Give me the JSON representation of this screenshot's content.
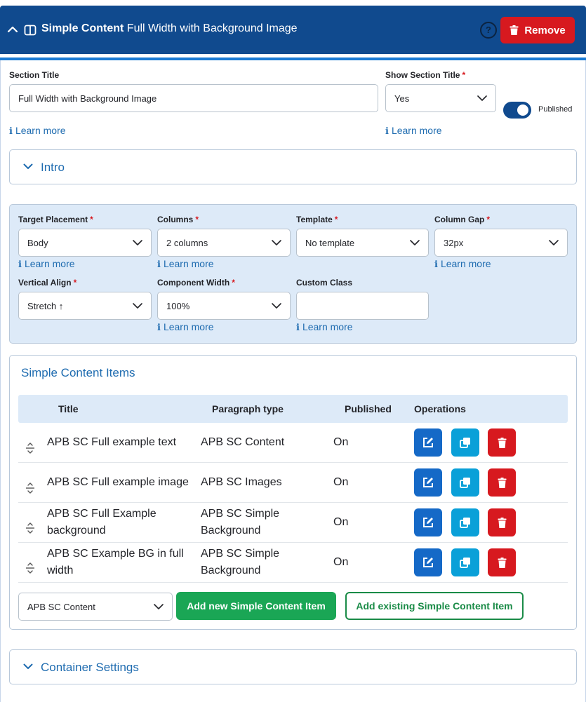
{
  "header": {
    "title_bold": "Simple Content",
    "title_rest": "Full Width with Background Image",
    "help_label": "?",
    "remove_label": "Remove"
  },
  "section_title": {
    "label": "Section Title",
    "value": "Full Width with Background Image",
    "learn_more": "Learn more"
  },
  "show_section_title": {
    "label": "Show Section Title",
    "required": "*",
    "value": "Yes",
    "learn_more": "Learn more"
  },
  "published_toggle": {
    "label": "Published",
    "on": true
  },
  "intro": {
    "label": "Intro"
  },
  "settings": {
    "target_placement": {
      "label": "Target Placement",
      "required": "*",
      "value": "Body",
      "learn_more": "Learn more"
    },
    "columns": {
      "label": "Columns",
      "required": "*",
      "value": "2 columns",
      "learn_more": "Learn more"
    },
    "template": {
      "label": "Template",
      "required": "*",
      "value": "No template"
    },
    "column_gap": {
      "label": "Column Gap",
      "required": "*",
      "value": "32px",
      "learn_more": "Learn more"
    },
    "vertical_align": {
      "label": "Vertical Align",
      "required": "*",
      "value": "Stretch ↑"
    },
    "component_width": {
      "label": "Component Width",
      "required": "*",
      "value": "100%",
      "learn_more": "Learn more"
    },
    "custom_class": {
      "label": "Custom Class",
      "value": "",
      "learn_more": "Learn more"
    }
  },
  "items_section": {
    "title": "Simple Content Items",
    "columns": [
      "Title",
      "Paragraph type",
      "Published",
      "Operations"
    ],
    "rows": [
      {
        "title": "APB SC Full example text",
        "type": "APB SC Content",
        "published": "On"
      },
      {
        "title": "APB SC Full example image",
        "type": "APB SC Images",
        "published": "On"
      },
      {
        "title": "APB SC Full Example background",
        "type": "APB SC Simple Background",
        "published": "On"
      },
      {
        "title": "APB SC Example BG in full width",
        "type": "APB SC Simple Background",
        "published": "On"
      }
    ],
    "add_type_value": "APB SC Content",
    "add_new_label": "Add new Simple Content Item",
    "add_existing_label": "Add existing Simple Content Item"
  },
  "container_settings": {
    "label": "Container Settings"
  },
  "colors": {
    "header_bg": "#104a8e",
    "accent_blue": "#1f6cb0",
    "remove_red": "#d7191f",
    "add_green": "#1aa655",
    "panel_bg": "#ddeaf8"
  },
  "icons": {
    "header_chevron": "chevron-up-icon",
    "header_section": "columns-icon",
    "remove": "trash-icon",
    "collapse": "chevron-down-icon",
    "drag": "drag-handle-icon",
    "edit": "edit-icon",
    "duplicate": "duplicate-icon",
    "delete": "trash-icon"
  }
}
